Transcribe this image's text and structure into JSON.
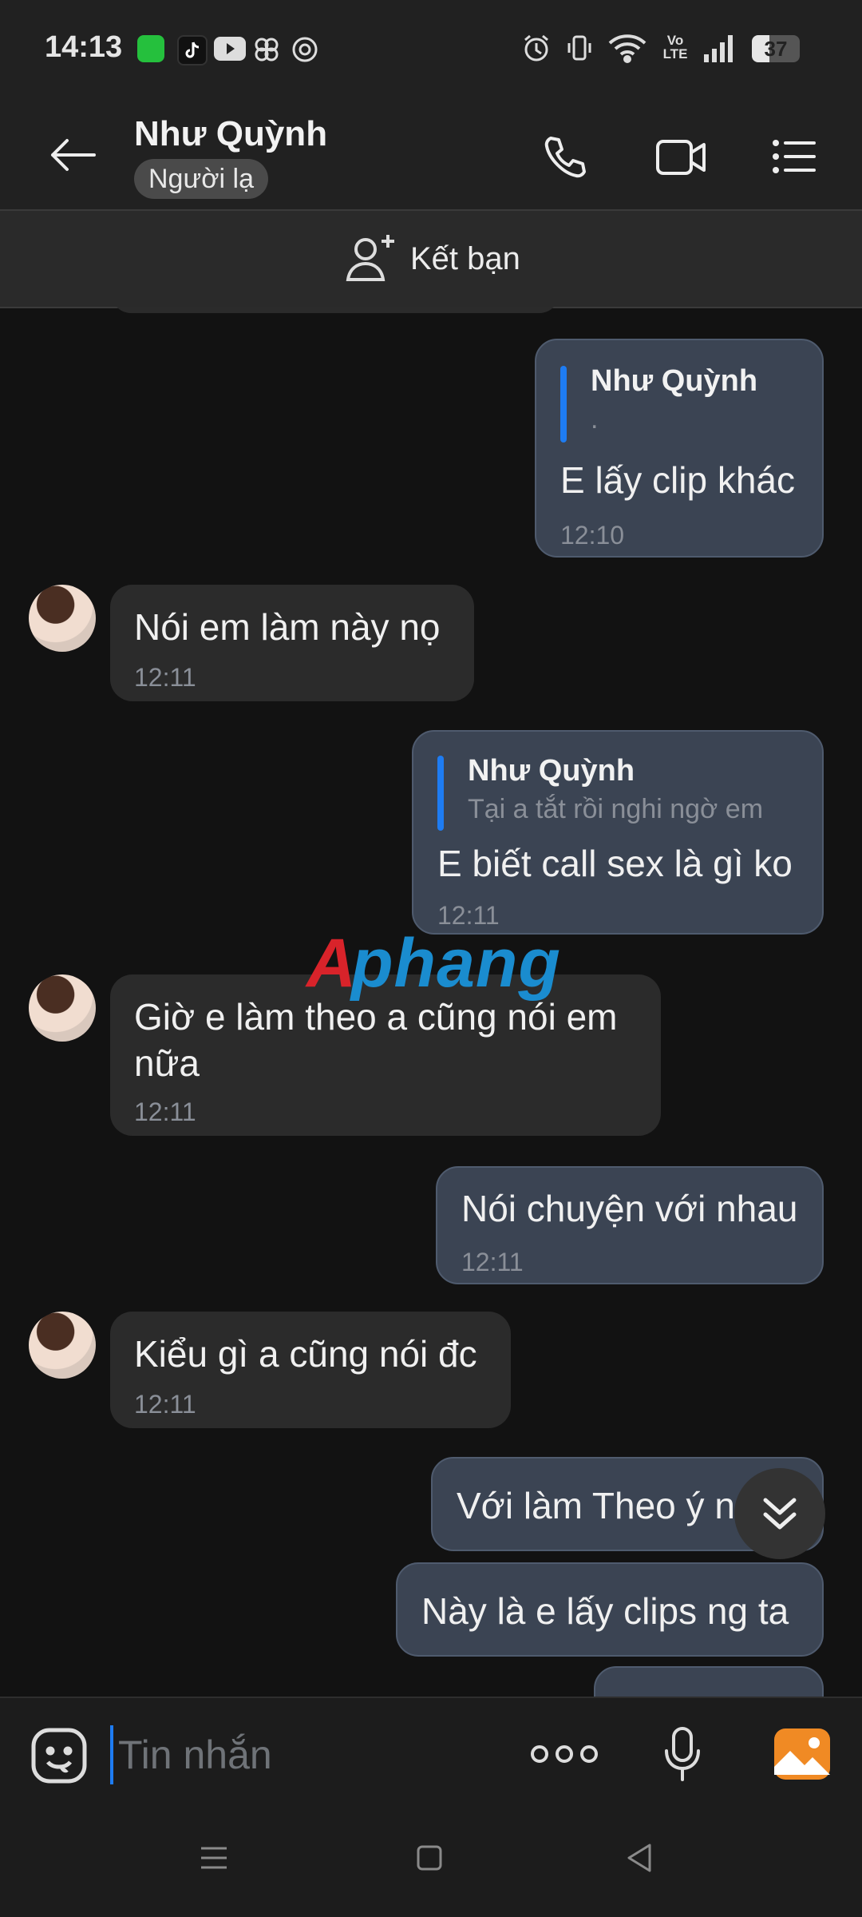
{
  "status_bar": {
    "time": "14:13",
    "battery": "37",
    "network": "Vo LTE",
    "icons": [
      "app-grid-icon",
      "tiktok-icon",
      "youtube-icon",
      "pinwheel-icon",
      "chrome-icon",
      "alarm-icon",
      "vibrate-icon",
      "wifi-icon",
      "signal-icon",
      "battery-icon"
    ]
  },
  "header": {
    "name": "Như Quỳnh",
    "badge": "Người lạ",
    "icons": [
      "back-arrow-icon",
      "phone-icon",
      "video-call-icon",
      "menu-list-icon"
    ]
  },
  "add_friend": {
    "label": "Kết bạn"
  },
  "messages": [
    {
      "dir": "out",
      "quote_name": "Như Quỳnh",
      "quote_text": ".",
      "text": "E lấy clip khác",
      "time": "12:10"
    },
    {
      "dir": "in",
      "text": "Nói em làm này nọ",
      "time": "12:11"
    },
    {
      "dir": "out",
      "quote_name": "Như Quỳnh",
      "quote_text": "Tại a tắt rồi nghi ngờ em",
      "text": "E biết call sex là gì ko",
      "time": "12:11"
    },
    {
      "dir": "in",
      "text_lines": [
        "Giờ e làm theo a cũng nói em",
        "nữa"
      ],
      "time": "12:11"
    },
    {
      "dir": "out",
      "text": "Nói chuyện với nhau",
      "time": "12:11"
    },
    {
      "dir": "in",
      "text": "Kiểu gì a cũng nói đc",
      "time": "12:11"
    },
    {
      "dir": "out",
      "text": "Với làm Theo ý n"
    },
    {
      "dir": "out",
      "text": "Này là e lấy clips ng ta"
    }
  ],
  "watermark": {
    "text": "Aphang",
    "colors": [
      "#d8232a",
      "#1a8ccf"
    ]
  },
  "input": {
    "placeholder": "Tin nhắn"
  },
  "input_icons": [
    "sticker-icon",
    "more-dots-icon",
    "microphone-icon",
    "image-gallery-icon"
  ],
  "colors": {
    "accent": "#1e7cf2",
    "out_bubble": "#3b4453",
    "in_bubble": "#2b2b2b",
    "gallery": "#f08a24"
  }
}
